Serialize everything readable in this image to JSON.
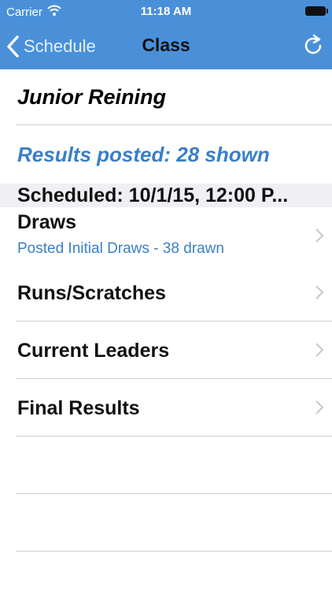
{
  "status_bar": {
    "carrier": "Carrier",
    "time": "11:18 AM",
    "wifi_icon": "wifi-icon",
    "battery_icon": "battery-icon"
  },
  "nav": {
    "back_label": "Schedule",
    "title": "Class",
    "refresh_icon": "refresh-icon",
    "accent_color": "#4a90d9"
  },
  "class_name": "Junior Reining",
  "results_posted": "Results posted: 28 shown",
  "scheduled": "Scheduled: 10/1/15, 12:00 P...",
  "menu": [
    {
      "label": "Draws",
      "subtitle": "Posted Initial Draws - 38 drawn"
    },
    {
      "label": "Runs/Scratches"
    },
    {
      "label": "Current Leaders"
    },
    {
      "label": "Final Results"
    }
  ]
}
